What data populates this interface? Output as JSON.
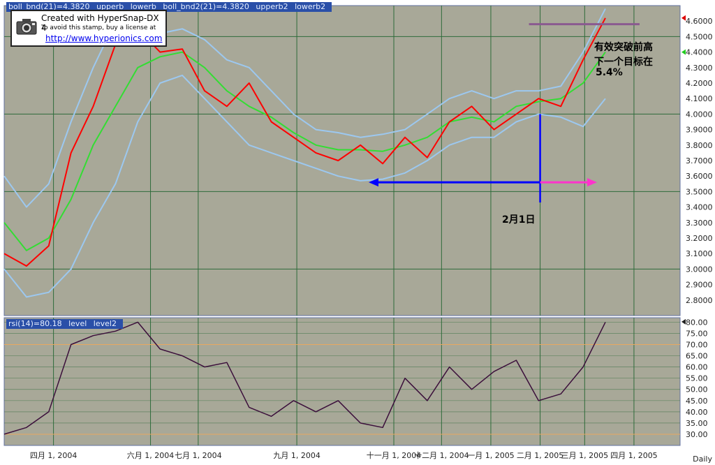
{
  "stamp": {
    "line1": "Created with HyperSnap-DX 4",
    "line2": "To avoid this stamp, buy a license at",
    "line3": "http://www.hyperionics.com"
  },
  "legend_price": [
    "boll_bnd(21)=4.3820",
    "upperb",
    "lowerb",
    "boll_bnd2(21)=4.3820",
    "upperb2",
    "lowerb2"
  ],
  "legend_rsi": [
    "rsi(14)=80.18",
    "level",
    "level2"
  ],
  "annotations": {
    "breakout_line1": "有效突破前高",
    "breakout_line2": "下一个目标在",
    "breakout_pct": "5.4%",
    "date_marker": "2月1日"
  },
  "period_label": "Daily",
  "colors": {
    "background": "#a8a898",
    "grid": "#2e6b3a",
    "price": "#ff0000",
    "middle_band": "#33dd33",
    "outer_bands": "#9cc8f0",
    "rsi": "#3b0f3b",
    "rsi_levels": "#e8a860",
    "resistance": "#8a5a90",
    "arrow_left": "#0000ff",
    "arrow_right": "#ff33cc"
  },
  "chart_data": [
    {
      "type": "line",
      "title": "",
      "xlabel": "",
      "ylabel": "",
      "ylim": [
        2.7,
        4.7
      ],
      "grid": true,
      "x_ticks": [
        "四月 1, 2004",
        "六月 1, 2004",
        "七月 1, 2004",
        "九月 1, 2004",
        "十一月 1, 2004",
        "十二月 1, 2004",
        "一月 1, 2005",
        "二月 1, 2005",
        "三月 1, 2005",
        "四月 1, 2005"
      ],
      "y_ticks": [
        "2.8000",
        "2.9000",
        "3.0000",
        "3.1000",
        "3.2000",
        "3.3000",
        "3.4000",
        "3.5000",
        "3.6000",
        "3.7000",
        "3.8000",
        "3.9000",
        "4.0000",
        "4.1000",
        "4.2000",
        "4.3000",
        "4.4000",
        "4.5000",
        "4.6000"
      ],
      "x_dates": [
        "2004-03-01",
        "2004-03-15",
        "2004-03-29",
        "2004-04-12",
        "2004-04-26",
        "2004-05-10",
        "2004-05-24",
        "2004-06-07",
        "2004-06-21",
        "2004-07-05",
        "2004-07-19",
        "2004-08-02",
        "2004-08-16",
        "2004-08-30",
        "2004-09-13",
        "2004-09-27",
        "2004-10-11",
        "2004-10-25",
        "2004-11-08",
        "2004-11-22",
        "2004-12-06",
        "2004-12-20",
        "2005-01-03",
        "2005-01-17",
        "2005-01-31",
        "2005-02-14",
        "2005-02-28",
        "2005-03-14"
      ],
      "series": [
        {
          "values": [
            3.1,
            3.02,
            3.15,
            3.75,
            4.05,
            4.45,
            4.55,
            4.4,
            4.42,
            4.15,
            4.05,
            4.2,
            3.95,
            3.85,
            3.75,
            3.7,
            3.8,
            3.68,
            3.85,
            3.72,
            3.95,
            4.05,
            3.9,
            4.0,
            4.1,
            4.05,
            4.35,
            4.62
          ]
        },
        {
          "values": [
            3.3,
            3.12,
            3.2,
            3.45,
            3.8,
            4.05,
            4.3,
            4.37,
            4.4,
            4.3,
            4.15,
            4.05,
            3.98,
            3.88,
            3.8,
            3.77,
            3.77,
            3.76,
            3.8,
            3.85,
            3.95,
            3.98,
            3.95,
            4.05,
            4.08,
            4.1,
            4.2,
            4.4
          ]
        },
        {
          "values": [
            3.6,
            3.4,
            3.55,
            3.95,
            4.3,
            4.6,
            4.65,
            4.52,
            4.55,
            4.48,
            4.35,
            4.3,
            4.15,
            4.0,
            3.9,
            3.88,
            3.85,
            3.87,
            3.9,
            4.0,
            4.1,
            4.15,
            4.1,
            4.15,
            4.15,
            4.18,
            4.4,
            4.68
          ]
        },
        {
          "values": [
            3.0,
            2.82,
            2.85,
            3.0,
            3.3,
            3.55,
            3.95,
            4.2,
            4.25,
            4.1,
            3.95,
            3.8,
            3.75,
            3.7,
            3.65,
            3.6,
            3.57,
            3.58,
            3.62,
            3.7,
            3.8,
            3.85,
            3.85,
            3.95,
            4.0,
            3.98,
            3.92,
            4.1
          ]
        }
      ],
      "resistance_level": 4.58,
      "date_marker_x": "2005-02-01",
      "arrow_y": 3.56
    },
    {
      "type": "line",
      "title": "",
      "ylim": [
        25,
        82
      ],
      "grid": true,
      "y_ticks": [
        "30.00",
        "35.00",
        "40.00",
        "45.00",
        "50.00",
        "55.00",
        "60.00",
        "65.00",
        "70.00",
        "75.00",
        "80.00"
      ],
      "series": [
        {
          "values": [
            30,
            33,
            40,
            70,
            74,
            76,
            80,
            68,
            65,
            60,
            62,
            42,
            38,
            45,
            40,
            45,
            35,
            33,
            55,
            45,
            60,
            50,
            58,
            63,
            45,
            48,
            60,
            80
          ]
        }
      ],
      "levels": [
        30,
        70
      ],
      "last_value": 80.18
    }
  ]
}
